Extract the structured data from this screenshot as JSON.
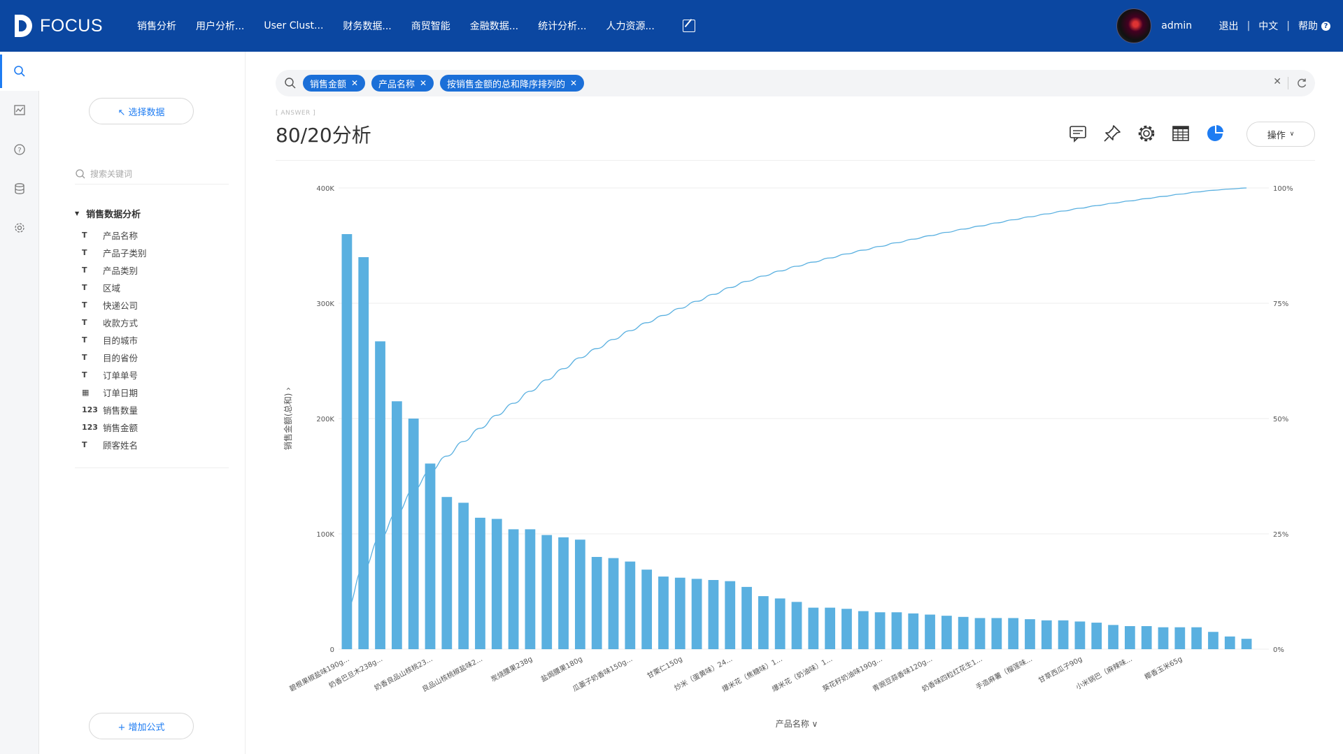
{
  "app": {
    "logo_text": "FOCUS"
  },
  "nav": [
    "销售分析",
    "用户分析...",
    "User Clust...",
    "财务数据...",
    "商贸智能",
    "金融数据...",
    "统计分析...",
    "人力资源..."
  ],
  "user": {
    "name": "admin",
    "logout": "退出",
    "language": "中文",
    "help": "帮助"
  },
  "rail": [
    "search-icon",
    "dashboard-icon",
    "help-icon",
    "database-icon",
    "settings-icon"
  ],
  "panel": {
    "select_data": "↖ 选择数据",
    "search_placeholder": "搜索关键词",
    "source_name": "销售数据分析",
    "add_formula": "+ 增加公式",
    "fields": [
      {
        "type": "text",
        "icon": "T",
        "label": "产品名称"
      },
      {
        "type": "text",
        "icon": "T",
        "label": "产品子类别"
      },
      {
        "type": "text",
        "icon": "T",
        "label": "产品类别"
      },
      {
        "type": "text",
        "icon": "T",
        "label": "区域"
      },
      {
        "type": "text",
        "icon": "T",
        "label": "快递公司"
      },
      {
        "type": "text",
        "icon": "T",
        "label": "收款方式"
      },
      {
        "type": "text",
        "icon": "T",
        "label": "目的城市"
      },
      {
        "type": "text",
        "icon": "T",
        "label": "目的省份"
      },
      {
        "type": "text",
        "icon": "T",
        "label": "订单单号"
      },
      {
        "type": "date",
        "icon": "▦",
        "label": "订单日期"
      },
      {
        "type": "number",
        "icon": "123",
        "label": "销售数量"
      },
      {
        "type": "number",
        "icon": "123",
        "label": "销售金额"
      },
      {
        "type": "text",
        "icon": "T",
        "label": "顾客姓名"
      }
    ]
  },
  "search": {
    "chips": [
      "销售金额",
      "产品名称",
      "按销售金额的总和降序排列的"
    ]
  },
  "answer": {
    "tag": "[ ANSWER ]",
    "title": "80/20分析"
  },
  "toolbar": {
    "icons": [
      "comment-icon",
      "pin-icon",
      "settings-icon",
      "table-icon",
      "pie-chart-icon"
    ],
    "ops": "操作"
  },
  "colors": {
    "topbar": "#0b47a1",
    "bar": "#5ab0e0",
    "line": "#5ab0e0",
    "chip": "#1b6fd8",
    "accent": "#1e7cf2"
  },
  "chart_data": {
    "type": "bar",
    "xlabel": "产品名称",
    "ylabel": "销售金额(总和)",
    "ylim": [
      0,
      400000
    ],
    "y_ticks": [
      "0",
      "100K",
      "200K",
      "300K",
      "400K"
    ],
    "y2_ticks": [
      "0%",
      "25%",
      "50%",
      "75%",
      "100%"
    ],
    "x_labels": [
      {
        "index": 0,
        "text": "碧根果椒盐味190g..."
      },
      {
        "index": 2,
        "text": "奶香巴旦木238g..."
      },
      {
        "index": 5,
        "text": "奶香良品山核桃23..."
      },
      {
        "index": 8,
        "text": "良品山核桃椒盐味2..."
      },
      {
        "index": 11,
        "text": "炭烧腰果238g"
      },
      {
        "index": 14,
        "text": "盐焗腰果180g"
      },
      {
        "index": 17,
        "text": "瓜蒌子奶香味150g..."
      },
      {
        "index": 20,
        "text": "甘栗仁150g"
      },
      {
        "index": 23,
        "text": "炒米（蛋黄味）24..."
      },
      {
        "index": 26,
        "text": "爆米花（焦糖味）1..."
      },
      {
        "index": 29,
        "text": "爆米花（奶油味）1..."
      },
      {
        "index": 32,
        "text": "葵花籽奶油味190g..."
      },
      {
        "index": 35,
        "text": "青豌豆蒜香味120g..."
      },
      {
        "index": 38,
        "text": "奶香味四粒红花生1..."
      },
      {
        "index": 41,
        "text": "手造麻薯（榴莲味..."
      },
      {
        "index": 44,
        "text": "甘草西瓜子90g"
      },
      {
        "index": 47,
        "text": "小米锅巴（麻辣味..."
      },
      {
        "index": 50,
        "text": "椰香玉米65g"
      }
    ],
    "values": [
      360000,
      340000,
      267000,
      215000,
      200000,
      161000,
      132000,
      127000,
      114000,
      113000,
      104000,
      104000,
      99000,
      97000,
      95000,
      80000,
      79000,
      76000,
      69000,
      63000,
      62000,
      61000,
      60000,
      59000,
      54000,
      46000,
      44000,
      41000,
      36000,
      36000,
      35000,
      33000,
      32000,
      32000,
      31000,
      30000,
      29000,
      28000,
      27000,
      27000,
      27000,
      26000,
      25000,
      25000,
      24000,
      23000,
      21000,
      20000,
      20000,
      19000,
      19000,
      19000,
      15000,
      11000,
      9000
    ],
    "cumulative_line": true
  }
}
